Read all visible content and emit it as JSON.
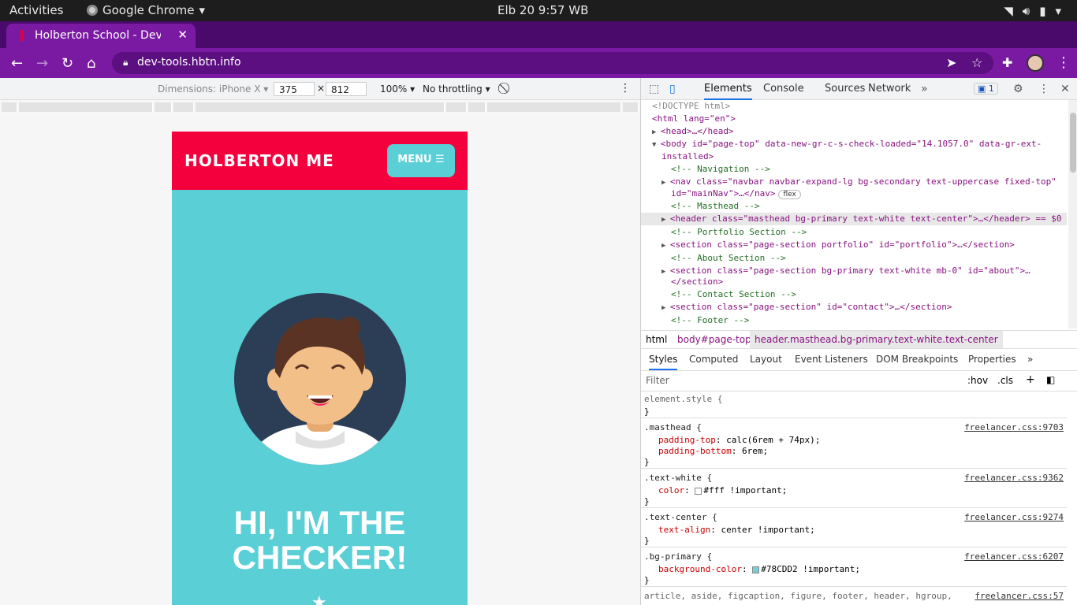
{
  "system": {
    "activities": "Activities",
    "app_name": "Google Chrome",
    "clock": "Elb 20  9:57 WB"
  },
  "browser": {
    "tab_title": "Holberton School - Develc",
    "url": "dev-tools.hbtn.info"
  },
  "devicebar": {
    "dimensions_label": "Dimensions: iPhone X",
    "width": "375",
    "height": "812",
    "times": "×",
    "zoom": "100%",
    "throttling": "No throttling"
  },
  "page": {
    "brand": "HOLBERTON ME",
    "menu": "MENU",
    "hero_line1": "HI, I'M THE",
    "hero_line2": "CHECKER!"
  },
  "devtools": {
    "tabs": [
      "Elements",
      "Console",
      "Sources",
      "Network"
    ],
    "issues_count": "1",
    "elements_lines": [
      {
        "t": "<!DOCTYPE html>",
        "cls": "dim"
      },
      {
        "t": "<html lang=\"en\">",
        "cls": "tag"
      },
      {
        "t": "<head>…</head>",
        "cls": "tag"
      },
      {
        "t": "<body id=\"page-top\" data-new-gr-c-s-check-loaded=\"14.1057.0\" data-gr-ext-",
        "cls": "tag"
      },
      {
        "t": "installed>",
        "cls": "tag"
      },
      {
        "t": "<!-- Navigation -->",
        "cls": "cmt"
      },
      {
        "t": "<nav class=\"navbar navbar-expand-lg bg-secondary text-uppercase fixed-top\"",
        "cls": "tag"
      },
      {
        "t": "id=\"mainNav\">…</nav>",
        "cls": "tag"
      },
      {
        "t": "<!-- Masthead -->",
        "cls": "cmt"
      },
      {
        "t": "<header class=\"masthead bg-primary text-white text-center\">…</header> == $0",
        "cls": "tag"
      },
      {
        "t": "<!-- Portfolio Section -->",
        "cls": "cmt"
      },
      {
        "t": "<section class=\"page-section portfolio\" id=\"portfolio\">…</section>",
        "cls": "tag"
      },
      {
        "t": "<!-- About Section -->",
        "cls": "cmt"
      },
      {
        "t": "<section class=\"page-section bg-primary text-white mb-0\" id=\"about\">…",
        "cls": "tag"
      },
      {
        "t": "</section>",
        "cls": "tag"
      },
      {
        "t": "<!-- Contact Section -->",
        "cls": "cmt"
      },
      {
        "t": "<section class=\"page-section\" id=\"contact\">…</section>",
        "cls": "tag"
      },
      {
        "t": "<!-- Footer -->",
        "cls": "cmt"
      }
    ],
    "flex_badge": "flex",
    "breadcrumbs": [
      "html",
      "body#page-top",
      "header.masthead.bg-primary.text-white.text-center"
    ],
    "style_tabs": [
      "Styles",
      "Computed",
      "Layout",
      "Event Listeners",
      "DOM Breakpoints",
      "Properties"
    ],
    "filter_placeholder": "Filter",
    "hov": ":hov",
    "cls": ".cls",
    "rules": [
      {
        "selector": "element.style {",
        "source": "",
        "props": [],
        "close": "}"
      },
      {
        "selector": ".masthead {",
        "source": "freelancer.css:9703",
        "props": [
          [
            "padding-top",
            "calc(6rem + 74px);"
          ],
          [
            "padding-bottom",
            "6rem;"
          ]
        ],
        "close": "}"
      },
      {
        "selector": ".text-white {",
        "source": "freelancer.css:9362",
        "props": [
          [
            "color",
            "#fff !important;"
          ]
        ],
        "close": "}"
      },
      {
        "selector": ".text-center {",
        "source": "freelancer.css:9274",
        "props": [
          [
            "text-align",
            "center !important;"
          ]
        ],
        "close": "}"
      },
      {
        "selector": ".bg-primary {",
        "source": "freelancer.css:6207",
        "props": [
          [
            "background-color",
            "#78CDD2 !important;"
          ]
        ],
        "close": "}"
      },
      {
        "selector": "article, aside, figcaption, figure, footer, header, hgroup,",
        "source": "freelancer.css:57",
        "props": [],
        "close": ""
      }
    ]
  },
  "colors": {
    "brand_red": "#f4003d",
    "primary_teal": "#5ad0d6",
    "browser_purple": "#7a1aa2"
  }
}
